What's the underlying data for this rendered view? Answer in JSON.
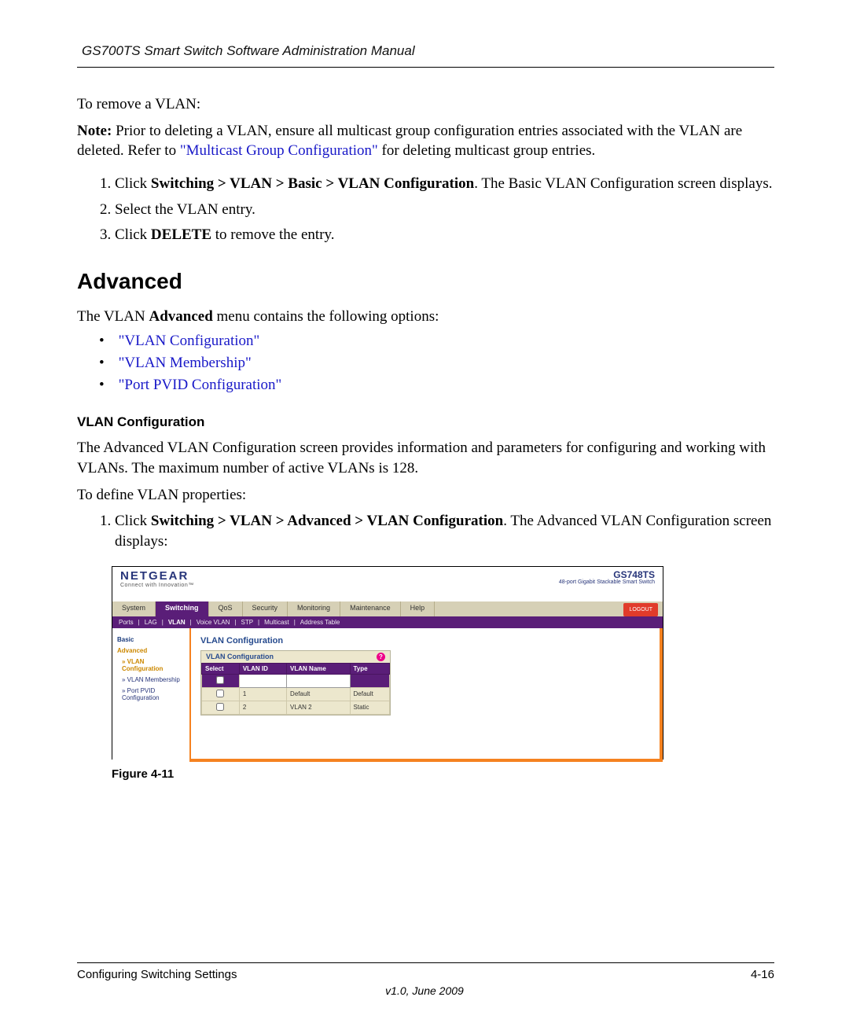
{
  "header": "GS700TS Smart Switch Software Administration Manual",
  "intro": "To remove a VLAN:",
  "note_label": "Note:",
  "note_text1": " Prior to deleting a VLAN, ensure all multicast group configuration entries associated with the VLAN are deleted. Refer to ",
  "note_link": "\"Multicast Group Configuration\"",
  "note_text2": " for deleting multicast group entries.",
  "steps_a": {
    "s1a": "Click ",
    "s1b": "Switching > VLAN > Basic > VLAN Configuration",
    "s1c": ". The Basic VLAN Configuration screen displays.",
    "s2": "Select the VLAN entry.",
    "s3a": "Click ",
    "s3b": "DELETE",
    "s3c": " to remove the entry."
  },
  "h2": "Advanced",
  "adv_intro1": "The VLAN ",
  "adv_intro_b": "Advanced",
  "adv_intro2": " menu contains the following options:",
  "bul": {
    "b1": "\"VLAN Configuration\"",
    "b2": "\"VLAN Membership\"",
    "b3": "\"Port PVID Configuration\""
  },
  "h3": "VLAN Configuration",
  "p2": "The Advanced VLAN Configuration screen provides information and parameters for configuring and working with VLANs. The maximum number of active VLANs is 128.",
  "p3": "To define VLAN properties:",
  "steps_b": {
    "s1a": "Click ",
    "s1b": "Switching > VLAN > Advanced > VLAN Configuration",
    "s1c": ". The Advanced VLAN Configuration screen displays:"
  },
  "ui": {
    "logo": "NETGEAR",
    "logo_sub": "Connect with Innovation™",
    "model": "GS748TS",
    "model_sub": "48-port Gigabit Stackable Smart Switch",
    "tabs": [
      "System",
      "Switching",
      "QoS",
      "Security",
      "Monitoring",
      "Maintenance",
      "Help"
    ],
    "active_tab": "Switching",
    "logout": "LOGOUT",
    "subtabs": [
      "Ports",
      "LAG",
      "VLAN",
      "Voice VLAN",
      "STP",
      "Multicast",
      "Address Table"
    ],
    "subtab_on": "VLAN",
    "side": {
      "basic": "Basic",
      "advanced": "Advanced",
      "vconf": "» VLAN Configuration",
      "vmem": "» VLAN Membership",
      "pvid": "» Port PVID Configuration"
    },
    "title": "VLAN Configuration",
    "panel_title": "VLAN Configuration",
    "cols": {
      "sel": "Select",
      "id": "VLAN ID",
      "name": "VLAN Name",
      "type": "Type"
    },
    "rows": [
      {
        "id": "1",
        "name": "Default",
        "type": "Default"
      },
      {
        "id": "2",
        "name": "VLAN 2",
        "type": "Static"
      }
    ]
  },
  "fig": "Figure 4-11",
  "footer_left": "Configuring Switching Settings",
  "footer_right": "4-16",
  "version": "v1.0, June 2009"
}
